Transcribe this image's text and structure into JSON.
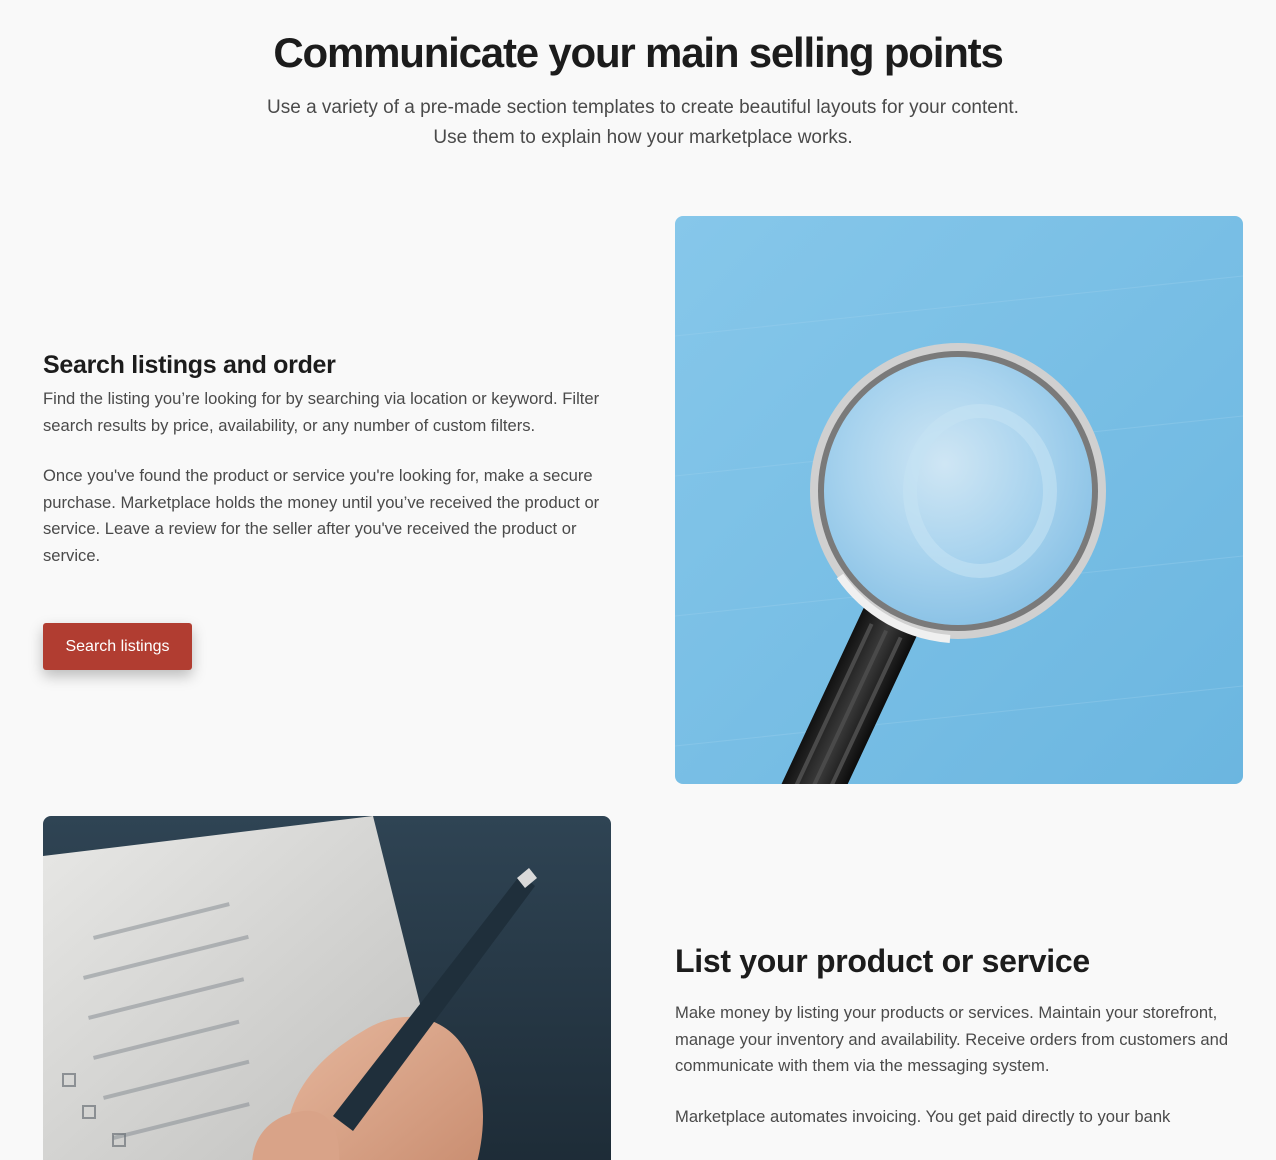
{
  "hero": {
    "title": "Communicate your main selling points",
    "subtitle": "Use a variety of a pre-made section templates to create beautiful layouts for your content. Use them to explain how your marketplace works."
  },
  "section_search": {
    "heading": "Search listings and order",
    "paragraph_1": "Find the listing you’re looking for by searching via location or keyword. Filter search results by price, availability, or any number of custom filters.",
    "paragraph_2": "Once you've found the product or service you're looking for, make a secure purchase. Marketplace holds the money until you’ve received the product or service. Leave a review for the seller after you've received the product or service.",
    "button_label": "Search listings",
    "image_icon": "magnifying-glass-photo"
  },
  "section_list": {
    "heading": "List your product or service",
    "paragraph_1": "Make money by listing your products or services. Maintain your storefront, manage your inventory and availability. Receive orders from customers and communicate with them via the messaging system.",
    "paragraph_2": "Marketplace automates invoicing. You get paid directly to your bank",
    "image_icon": "handwriting-checklist-photo"
  },
  "colors": {
    "background": "#f9f9f9",
    "accent": "#b13d31",
    "heading": "#1c1c1c",
    "body": "#4a4a4a",
    "magnifier_backdrop": "#7cc0e6"
  }
}
